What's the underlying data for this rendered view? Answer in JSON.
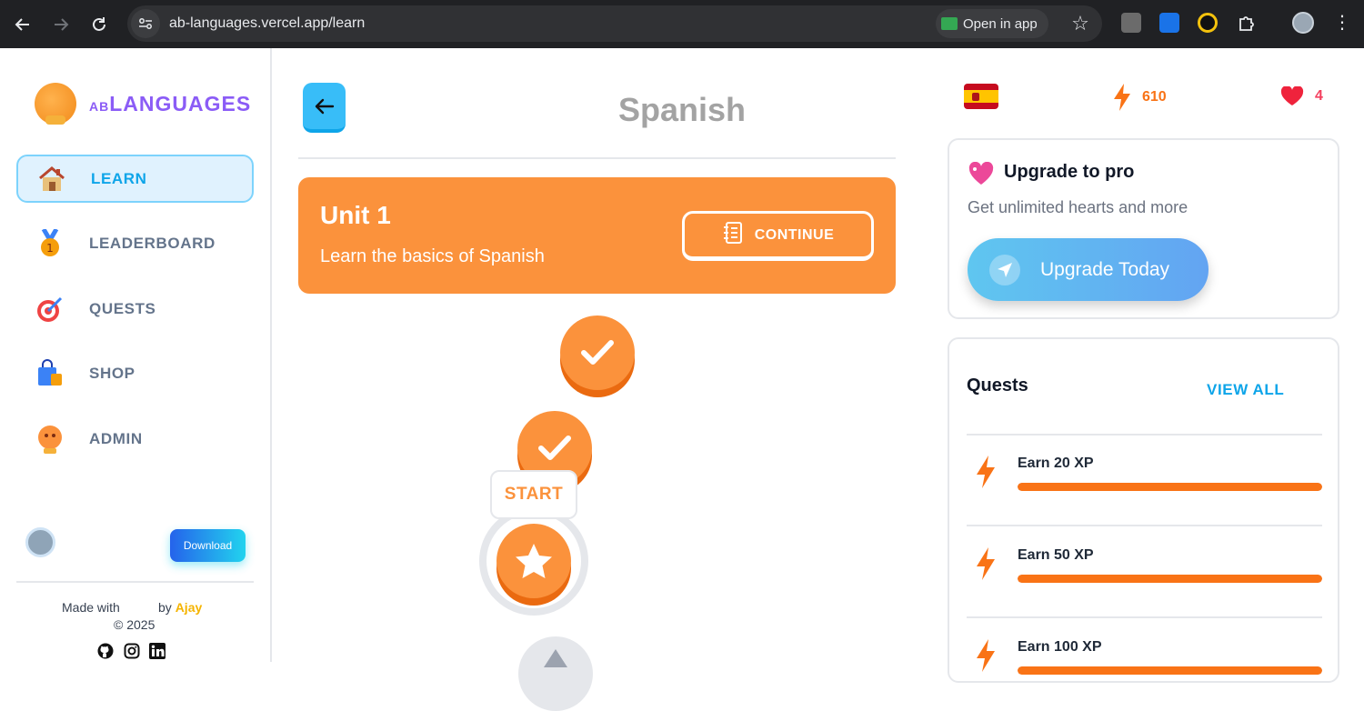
{
  "browser": {
    "url": "ab-languages.vercel.app/learn",
    "open_in_app_label": "Open in app"
  },
  "sidebar": {
    "brand_prefix": "AB",
    "brand_word": "LANGUAGES",
    "items": [
      {
        "label": "LEARN",
        "icon": "house-icon",
        "active": true
      },
      {
        "label": "LEADERBOARD",
        "icon": "medal-icon",
        "active": false
      },
      {
        "label": "QUESTS",
        "icon": "target-icon",
        "active": false
      },
      {
        "label": "SHOP",
        "icon": "shopping-bag-icon",
        "active": false
      },
      {
        "label": "ADMIN",
        "icon": "mascot-icon",
        "active": false
      }
    ],
    "download_label": "Download",
    "footer": {
      "made_with": "Made with",
      "by": "by",
      "author": "Ajay",
      "copyright": "© 2025"
    }
  },
  "main": {
    "course_title": "Spanish",
    "unit": {
      "title": "Unit 1",
      "description": "Learn the basics of Spanish",
      "continue_label": "CONTINUE"
    },
    "start_label": "START",
    "lessons": [
      {
        "state": "completed"
      },
      {
        "state": "completed"
      },
      {
        "state": "current"
      },
      {
        "state": "locked"
      }
    ]
  },
  "stats": {
    "language_flag": "spain-flag-icon",
    "xp": "610",
    "hearts": "4"
  },
  "pro": {
    "title": "Upgrade to pro",
    "subtitle": "Get unlimited hearts and more",
    "button_label": "Upgrade Today"
  },
  "quests": {
    "title": "Quests",
    "view_all_label": "VIEW ALL",
    "items": [
      {
        "label": "Earn 20 XP",
        "progress": 1.0
      },
      {
        "label": "Earn 50 XP",
        "progress": 1.0
      },
      {
        "label": "Earn 100 XP",
        "progress": 1.0
      }
    ]
  },
  "colors": {
    "accent_orange": "#fb923c",
    "accent_sky": "#38bdf8",
    "brand_purple": "#8b5cf6"
  }
}
